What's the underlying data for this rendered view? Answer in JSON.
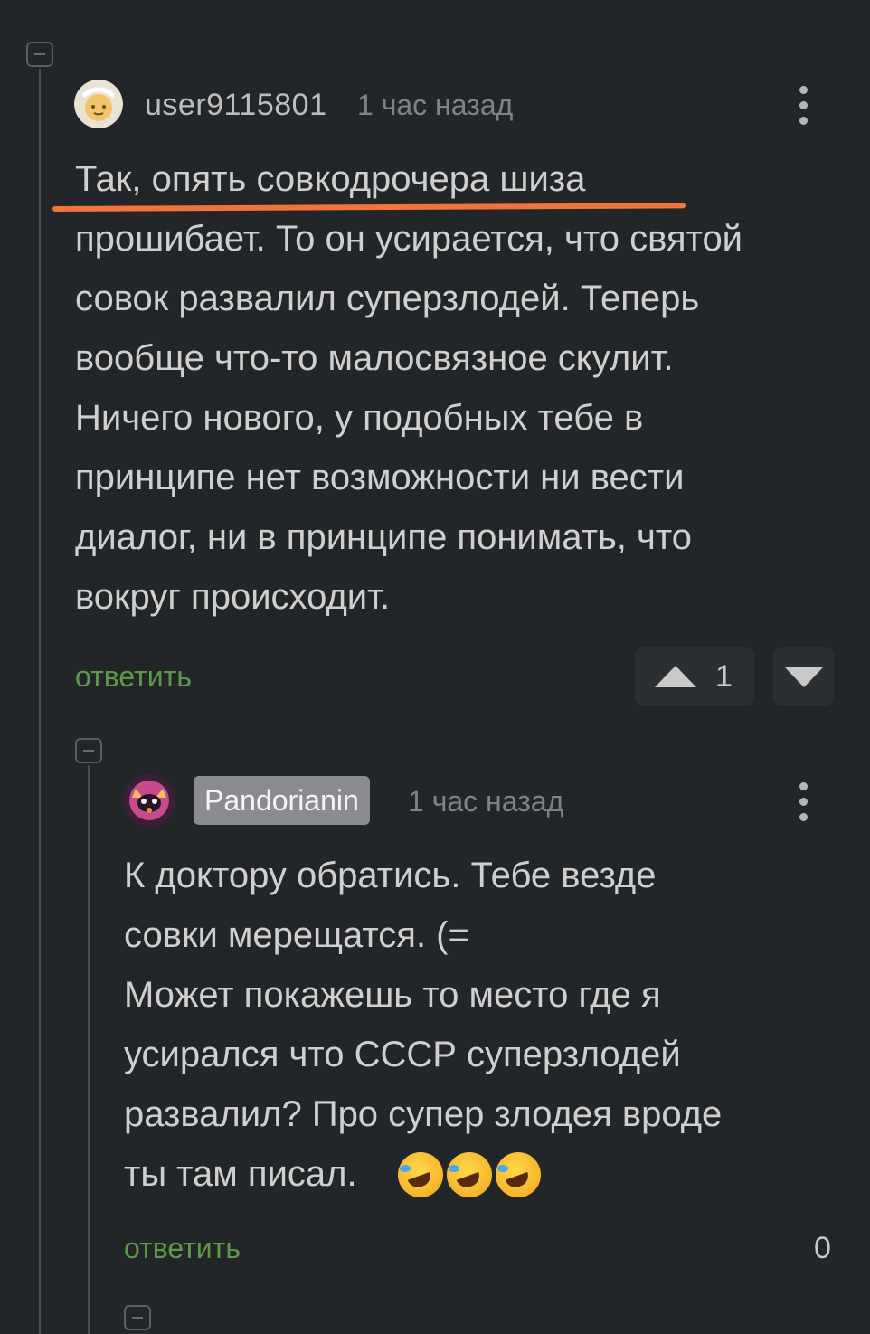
{
  "comments": [
    {
      "username": "user9115801",
      "time": "1 час назад",
      "text_line1": "Так, опять совкодрочера шиза",
      "text_rest": "прошибает. То он усирается, что святой\nсовок развалил суперзлодей. Теперь\nвообще что-то малосвязное скулит.\nНичего нового, у подобных тебе в\nпринципе нет возможности ни вести\nдиалог, ни в принципе понимать, что\nвокруг происходит.",
      "reply_label": "ответить",
      "score": "1",
      "highlight_color": "#f0743b"
    },
    {
      "username": "Pandorianin",
      "time": "1 час назад",
      "text": "К доктору обратись. Тебе везде\nсовки мерещатся. (=\nМожет покажешь то место где я\nусирался что СССР суперзлодей\nразвалил? Про супер злодея вроде",
      "text_last": "ты там писал.",
      "emojis": [
        "rolling-on-floor-laughing",
        "rolling-on-floor-laughing",
        "rolling-on-floor-laughing"
      ],
      "reply_label": "ответить",
      "score": "0"
    }
  ],
  "colors": {
    "background": "#232628",
    "reply_link": "#5c9a49",
    "badge": "#8a8c8f"
  }
}
